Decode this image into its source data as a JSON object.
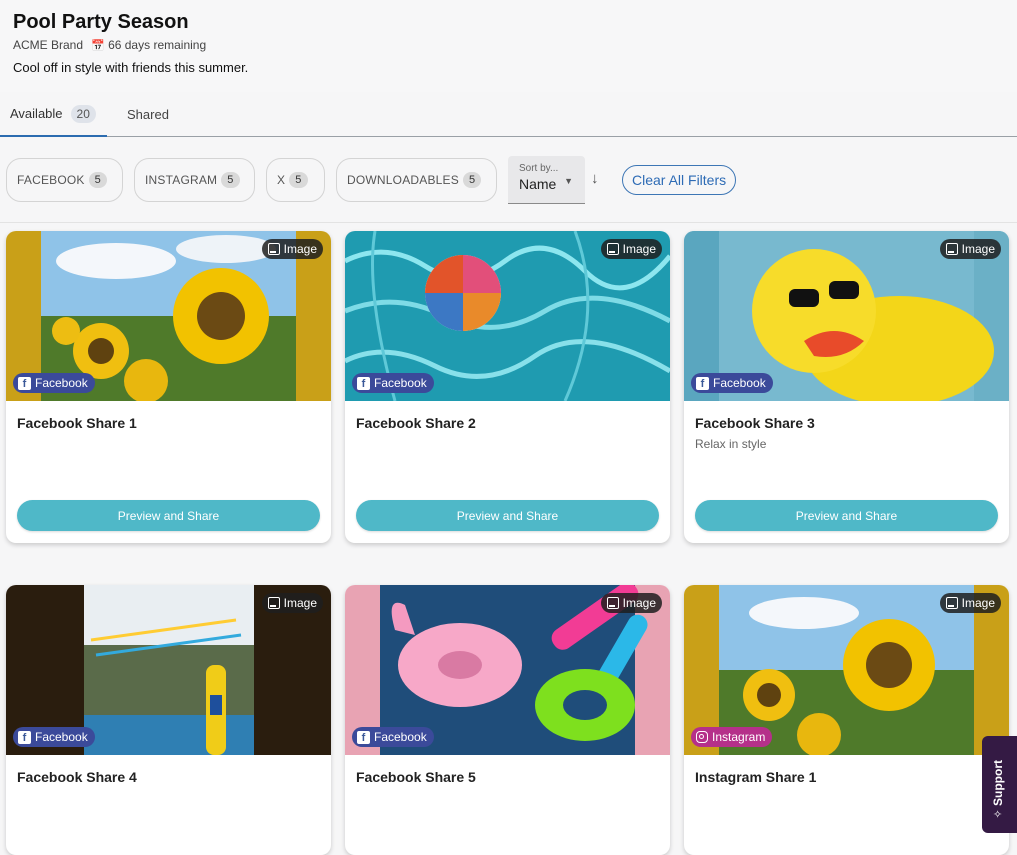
{
  "campaign": {
    "title": "Pool Party Season",
    "brand": "ACME Brand",
    "remaining": "66 days remaining",
    "description": "Cool off in style with friends this summer."
  },
  "tabs": [
    {
      "label": "Available",
      "count": "20"
    },
    {
      "label": "Shared"
    }
  ],
  "filters": [
    {
      "label": "FACEBOOK",
      "count": "5"
    },
    {
      "label": "INSTAGRAM",
      "count": "5"
    },
    {
      "label": "X",
      "count": "5"
    },
    {
      "label": "DOWNLOADABLES",
      "count": "5"
    }
  ],
  "sort": {
    "label": "Sort by...",
    "value": "Name"
  },
  "clear_filters": "Clear All Filters",
  "cards": [
    {
      "title": "Facebook Share 1",
      "subtitle": "",
      "network": "Facebook",
      "type": "Image",
      "button": "Preview and Share"
    },
    {
      "title": "Facebook Share 2",
      "subtitle": "",
      "network": "Facebook",
      "type": "Image",
      "button": "Preview and Share"
    },
    {
      "title": "Facebook Share 3",
      "subtitle": "Relax in style",
      "network": "Facebook",
      "type": "Image",
      "button": "Preview and Share"
    },
    {
      "title": "Facebook Share 4",
      "subtitle": "",
      "network": "Facebook",
      "type": "Image"
    },
    {
      "title": "Facebook Share 5",
      "subtitle": "",
      "network": "Facebook",
      "type": "Image"
    },
    {
      "title": "Instagram Share 1",
      "subtitle": "",
      "network": "Instagram",
      "type": "Image"
    }
  ],
  "support": "Support",
  "colors": {
    "accent_button": "#4fb8c8",
    "facebook_badge": "#3b4a9a",
    "instagram_badge": "#b5308a",
    "support_bg": "#341a44",
    "link_blue": "#2d6bb5"
  },
  "icons": {
    "calendar": "calendar-icon",
    "image": "image-icon",
    "facebook": "facebook-icon",
    "instagram": "instagram-icon",
    "sort_direction": "arrow-down-icon",
    "support": "sparkle-icon"
  }
}
